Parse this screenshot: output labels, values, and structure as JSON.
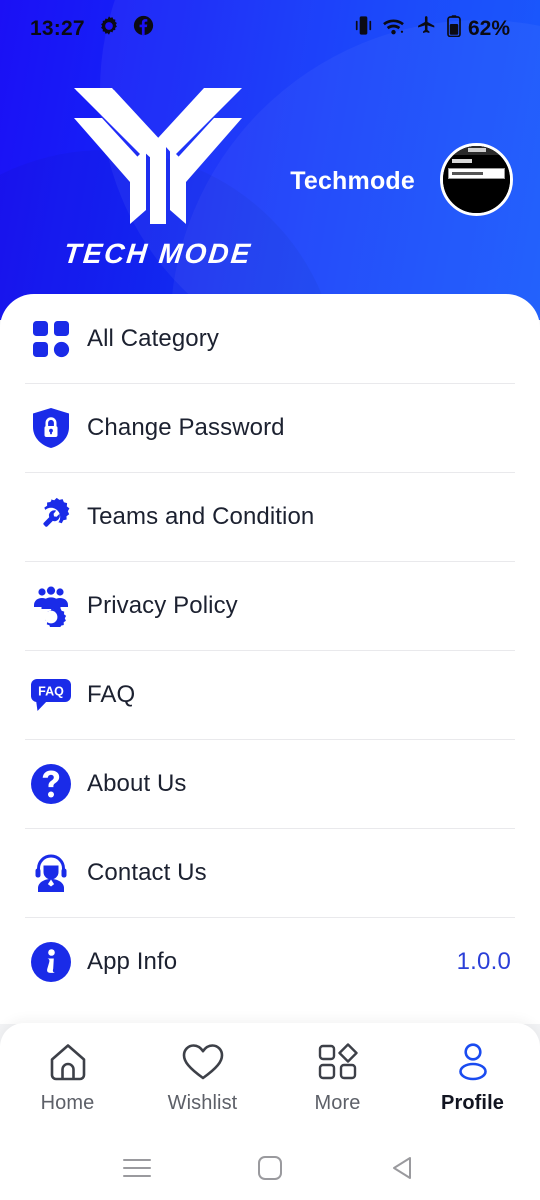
{
  "status_bar": {
    "time": "13:27",
    "battery_text": "62%",
    "left_icons": [
      "settings-gear-icon",
      "facebook-icon"
    ],
    "right_icons": [
      "vibrate-icon",
      "wifi-icon",
      "airplane-mode-icon",
      "battery-icon"
    ]
  },
  "header": {
    "logo_text": "TECH MODE",
    "brand_name": "Techmode",
    "avatar_name": "user-avatar",
    "gradient_start": "#1b10f5",
    "gradient_end": "#0d52fc"
  },
  "menu": {
    "items": [
      {
        "label": "All Category",
        "icon": "grid-category-icon",
        "value": ""
      },
      {
        "label": "Change Password",
        "icon": "shield-lock-icon",
        "value": ""
      },
      {
        "label": "Teams and Condition",
        "icon": "gear-wrench-icon",
        "value": ""
      },
      {
        "label": "Privacy Policy",
        "icon": "people-gear-icon",
        "value": ""
      },
      {
        "label": "FAQ",
        "icon": "faq-bubble-icon",
        "value": ""
      },
      {
        "label": "About Us",
        "icon": "question-circle-icon",
        "value": ""
      },
      {
        "label": "Contact Us",
        "icon": "headset-support-icon",
        "value": ""
      },
      {
        "label": "App Info",
        "icon": "info-circle-icon",
        "value": "1.0.0"
      }
    ],
    "icon_color": "#1a2be8",
    "value_color": "#2b3fd8"
  },
  "bottom_nav": {
    "active": "Profile",
    "items": [
      {
        "label": "Home",
        "icon": "home-icon"
      },
      {
        "label": "Wishlist",
        "icon": "heart-icon"
      },
      {
        "label": "More",
        "icon": "grid-more-icon"
      },
      {
        "label": "Profile",
        "icon": "person-icon"
      }
    ],
    "active_color": "#1a4bf0"
  },
  "android_nav": {
    "buttons": [
      "recents-icon",
      "home-square-icon",
      "back-triangle-icon"
    ]
  }
}
